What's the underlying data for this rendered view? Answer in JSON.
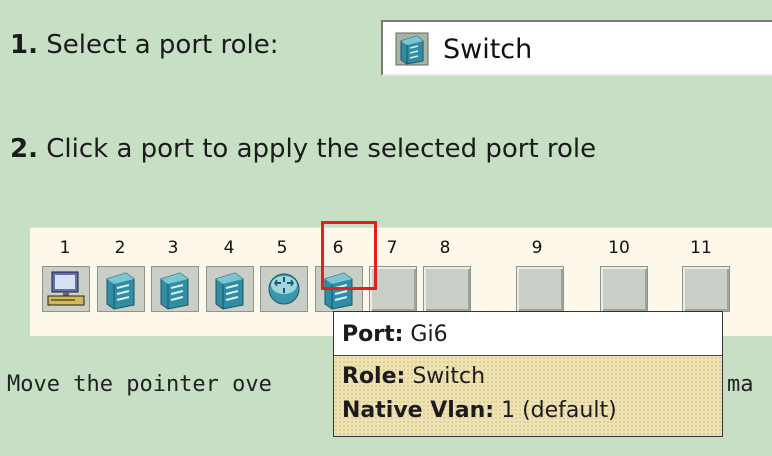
{
  "step1": {
    "num": "1.",
    "text": "Select a port role:"
  },
  "role_select": {
    "value": "Switch",
    "icon": "switch-icon"
  },
  "step2": {
    "num": "2.",
    "text": "Click a port to apply the selected port role"
  },
  "ports": [
    {
      "number": "1",
      "role": "desktop"
    },
    {
      "number": "2",
      "role": "switch"
    },
    {
      "number": "3",
      "role": "switch"
    },
    {
      "number": "4",
      "role": "switch"
    },
    {
      "number": "5",
      "role": "router"
    },
    {
      "number": "6",
      "role": "switch",
      "selected": true
    },
    {
      "number": "7",
      "role": "none"
    },
    {
      "number": "8",
      "role": "none"
    },
    {
      "number": "9",
      "role": "none"
    },
    {
      "number": "10",
      "role": "none"
    },
    {
      "number": "11",
      "role": "none"
    }
  ],
  "hint": {
    "left": "Move the pointer ove",
    "right": "ma"
  },
  "tooltip": {
    "port_label": "Port:",
    "port_value": "Gi6",
    "role_label": "Role:",
    "role_value": "Switch",
    "vlan_label": "Native Vlan:",
    "vlan_value": "1 (default)"
  },
  "colors": {
    "background": "#c6dfc5",
    "selection": "#e3211b",
    "strip": "#fdf8ea",
    "tooltip_body": "#efe3b3"
  }
}
